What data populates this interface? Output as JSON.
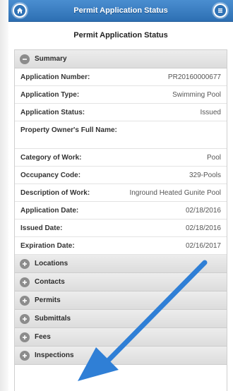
{
  "header": {
    "title": "Permit Application Status",
    "left_icon": "home-icon",
    "right_icon": "menu-icon"
  },
  "page": {
    "title": "Permit Application Status"
  },
  "summary": {
    "label": "Summary",
    "icon": "minus-circle-icon",
    "rows": [
      {
        "label": "Application Number:",
        "value": "PR20160000677"
      },
      {
        "label": "Application Type:",
        "value": "Swimming Pool"
      },
      {
        "label": "Application Status:",
        "value": "Issued"
      },
      {
        "label": "Property Owner's Full Name:",
        "value": ""
      },
      {
        "label": "Category of Work:",
        "value": "Pool"
      },
      {
        "label": "Occupancy Code:",
        "value": "329-Pools"
      },
      {
        "label": "Description of Work:",
        "value": "Inground Heated Gunite Pool"
      },
      {
        "label": "Application Date:",
        "value": "02/18/2016"
      },
      {
        "label": "Issued Date:",
        "value": "02/18/2016"
      },
      {
        "label": "Expiration Date:",
        "value": "02/16/2017"
      }
    ]
  },
  "sections": [
    {
      "label": "Locations"
    },
    {
      "label": "Contacts"
    },
    {
      "label": "Permits"
    },
    {
      "label": "Submittals"
    },
    {
      "label": "Fees"
    },
    {
      "label": "Inspections"
    }
  ],
  "colors": {
    "header": "#2d6fb3",
    "annotation_arrow": "#2f7fd6"
  }
}
